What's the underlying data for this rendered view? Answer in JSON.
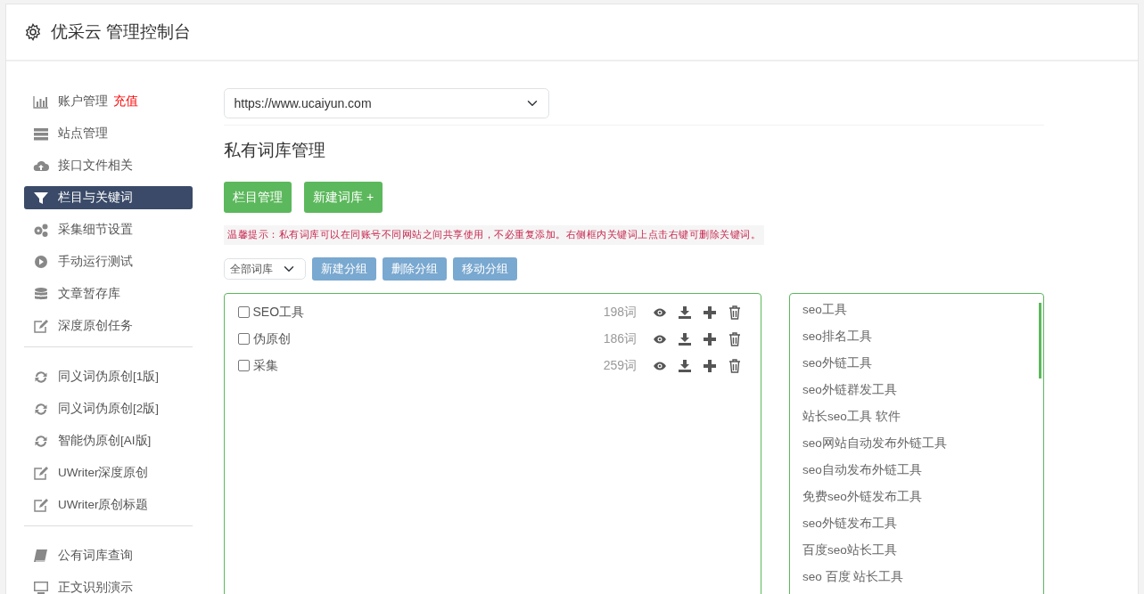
{
  "header": {
    "title": "优采云 管理控制台"
  },
  "sidebar": {
    "groups": [
      [
        {
          "label": "账户管理",
          "badge": "充值",
          "selected": false
        },
        {
          "label": "站点管理",
          "selected": false
        },
        {
          "label": "接口文件相关",
          "selected": false
        },
        {
          "label": "栏目与关键词",
          "selected": true
        },
        {
          "label": "采集细节设置",
          "selected": false
        },
        {
          "label": "手动运行测试",
          "selected": false
        },
        {
          "label": "文章暂存库",
          "selected": false
        },
        {
          "label": "深度原创任务",
          "selected": false
        }
      ],
      [
        {
          "label": "同义词伪原创[1版]",
          "selected": false
        },
        {
          "label": "同义词伪原创[2版]",
          "selected": false
        },
        {
          "label": "智能伪原创[AI版]",
          "selected": false
        },
        {
          "label": "UWriter深度原创",
          "selected": false
        },
        {
          "label": "UWriter原创标题",
          "selected": false
        }
      ],
      [
        {
          "label": "公有词库查询",
          "selected": false
        },
        {
          "label": "正文识别演示",
          "selected": false
        }
      ]
    ]
  },
  "site_select": {
    "value": "https://www.ucaiyun.com"
  },
  "page_title": "私有词库管理",
  "action_buttons": [
    "栏目管理",
    "新建词库 +"
  ],
  "tip": "温馨提示：私有词库可以在同账号不同网站之间共享使用，不必重复添加。右侧框内关键词上点击右键可删除关键词。",
  "library_filter": {
    "value": "全部词库"
  },
  "group_buttons": [
    {
      "label": "新建分组",
      "disabled": true
    },
    {
      "label": "删除分组",
      "disabled": true
    },
    {
      "label": "移动分组",
      "disabled": true
    }
  ],
  "libraries": [
    {
      "name": "SEO工具",
      "count": "198词",
      "checked": false
    },
    {
      "name": "伪原创",
      "count": "186词",
      "checked": false
    },
    {
      "name": "采集",
      "count": "259词",
      "checked": false
    }
  ],
  "keywords": [
    "seo工具",
    "seo排名工具",
    "seo外链工具",
    "seo外链群发工具",
    "站长seo工具 软件",
    "seo网站自动发布外链工具",
    "seo自动发布外链工具",
    "免费seo外链发布工具",
    "seo外链发布工具",
    "百度seo站长工具",
    "seo 百度 站长工具"
  ]
}
